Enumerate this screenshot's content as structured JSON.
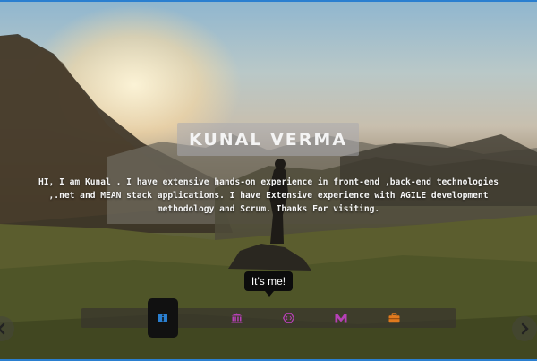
{
  "hero": {
    "name": "KUNAL VERMA",
    "intro": "HI, I am Kunal . I have extensive hands-on experience in front-end ,back-end technologies ,.net and MEAN stack applications. I have Extensive experience with AGILE development methodology and Scrum. Thanks For visiting."
  },
  "tooltip": {
    "text": "It's me!"
  },
  "nav": {
    "items": [
      {
        "icon": "info-icon",
        "color": "#2a7fd0",
        "active": true
      },
      {
        "icon": "bank-icon",
        "color": "#b640b6",
        "active": false
      },
      {
        "icon": "code-icon",
        "color": "#b640b6",
        "active": false
      },
      {
        "icon": "m-letter-icon",
        "color": "#b640b6",
        "active": false
      },
      {
        "icon": "briefcase-icon",
        "color": "#e07a1e",
        "active": false
      }
    ]
  },
  "arrows": {
    "left": "arrow-left-icon",
    "right": "arrow-right-icon"
  }
}
